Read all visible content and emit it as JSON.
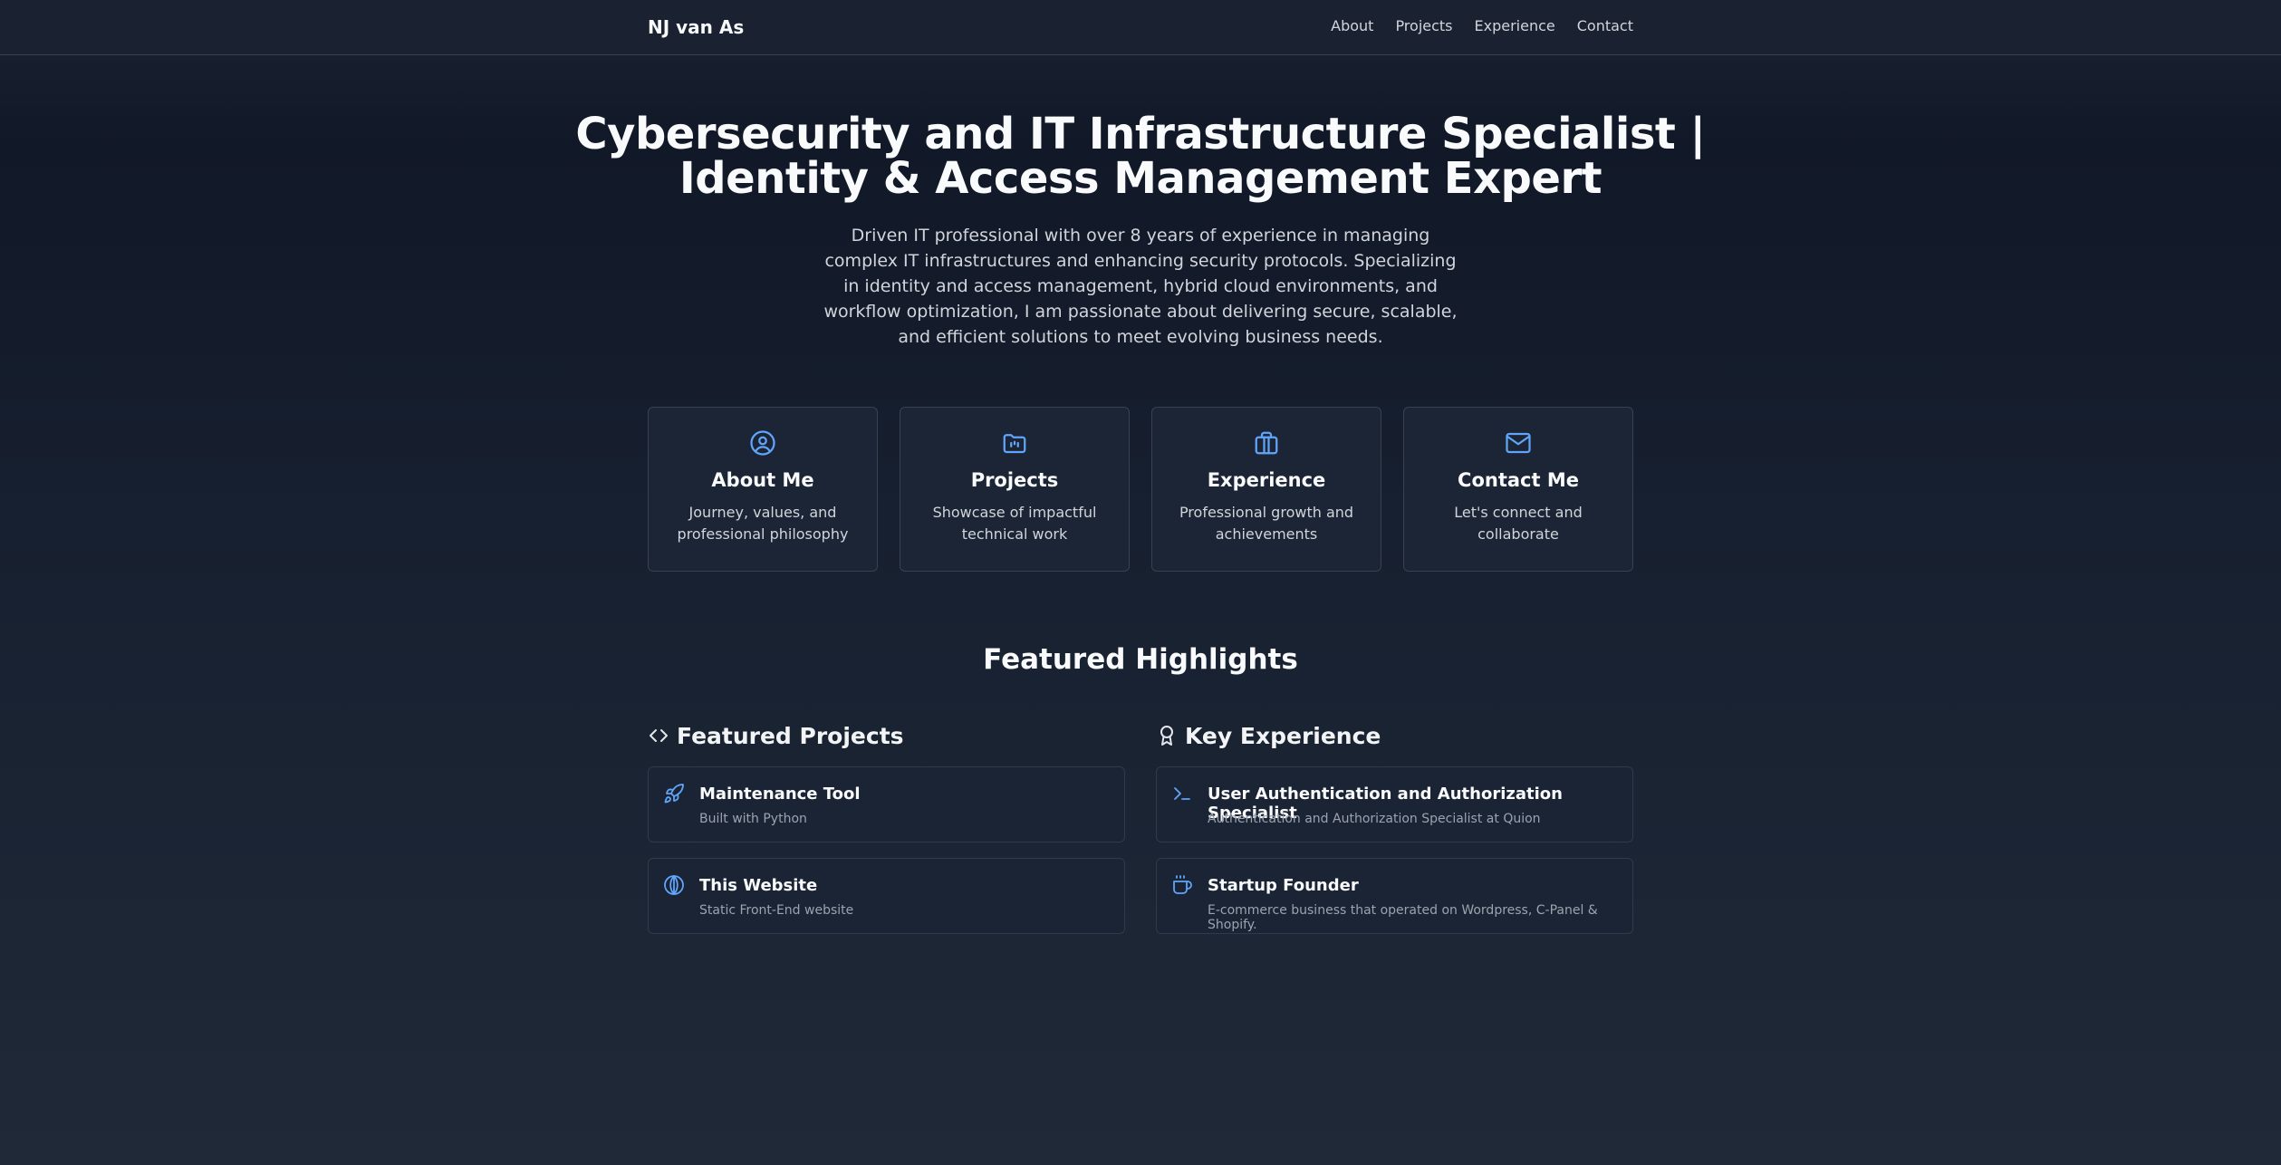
{
  "nav": {
    "brand": "NJ van As",
    "links": [
      "About",
      "Projects",
      "Experience",
      "Contact"
    ]
  },
  "hero": {
    "title_line1": "Cybersecurity and IT Infrastructure Specialist |",
    "title_line2": "Identity & Access Management Expert",
    "subtitle": "Driven IT professional with over 8 years of experience in managing complex IT infrastructures and enhancing security protocols. Specializing in identity and access management, hybrid cloud environments, and workflow optimization, I am passionate about delivering secure, scalable, and efficient solutions to meet evolving business needs."
  },
  "cards": [
    {
      "icon": "user-circle-icon",
      "title": "About Me",
      "desc": "Journey, values, and professional philosophy"
    },
    {
      "icon": "folder-icon",
      "title": "Projects",
      "desc": "Showcase of impactful technical work"
    },
    {
      "icon": "briefcase-icon",
      "title": "Experience",
      "desc": "Professional growth and achievements"
    },
    {
      "icon": "mail-icon",
      "title": "Contact Me",
      "desc": "Let's connect and collaborate"
    }
  ],
  "featured": {
    "heading": "Featured Highlights",
    "projects": {
      "heading": "Featured Projects",
      "icon": "code-icon",
      "items": [
        {
          "icon": "rocket-icon",
          "title": "Maintenance Tool",
          "sub": "Built with Python"
        },
        {
          "icon": "globe-icon",
          "title": "This Website",
          "sub": "Static Front-End website"
        }
      ]
    },
    "experience": {
      "heading": "Key Experience",
      "icon": "award-icon",
      "items": [
        {
          "icon": "terminal-icon",
          "title": "User Authentication and Authorization Specialist",
          "sub": "Authentication and Authorization Specialist at Quion"
        },
        {
          "icon": "coffee-icon",
          "title": "Startup Founder",
          "sub": "E-commerce business that operated on Wordpress, C-Panel & Shopify."
        }
      ]
    }
  },
  "colors": {
    "accent": "#60a5fa",
    "background": "#111827",
    "card": "#1c2535",
    "border": "#374151"
  }
}
